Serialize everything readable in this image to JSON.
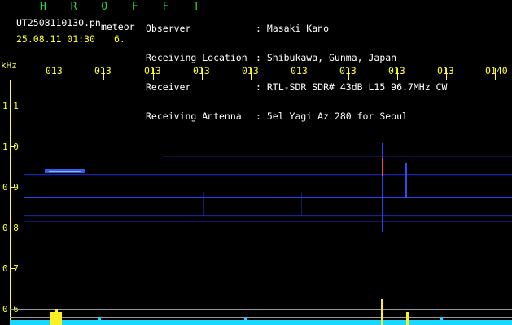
{
  "header": {
    "brand": "H R O F F T",
    "filename": "UT2508110130.pn",
    "meteor_tag": "meteor",
    "datetime": "25.08.11 01:30",
    "count": "6."
  },
  "meta": {
    "observer_label": "Observer",
    "observer_value": ": Masaki Kano",
    "location_label": "Receiving Location",
    "location_value": ": Shibukawa, Gunma, Japan",
    "receiver_label": "Receiver",
    "receiver_value": ": RTL-SDR SDR# 43dB L15 96.7MHz CW",
    "antenna_label": "Receiving Antenna",
    "antenna_value": ": 5el Yagi Az 280 for Seoul"
  },
  "axis": {
    "y_unit": "kHz",
    "x_ticks": [
      "013",
      "013",
      "013",
      "013",
      "013",
      "013",
      "013",
      "013",
      "013",
      "0140"
    ],
    "y_ticks": [
      "1.1",
      "1.0",
      "0.9",
      "0.8",
      "0.7",
      "0.6"
    ]
  },
  "colors": {
    "grid_tick": "#ffff2a",
    "brand": "#2fd64a",
    "trace": "#2233dd",
    "spectrum": "#18d8ff"
  }
}
